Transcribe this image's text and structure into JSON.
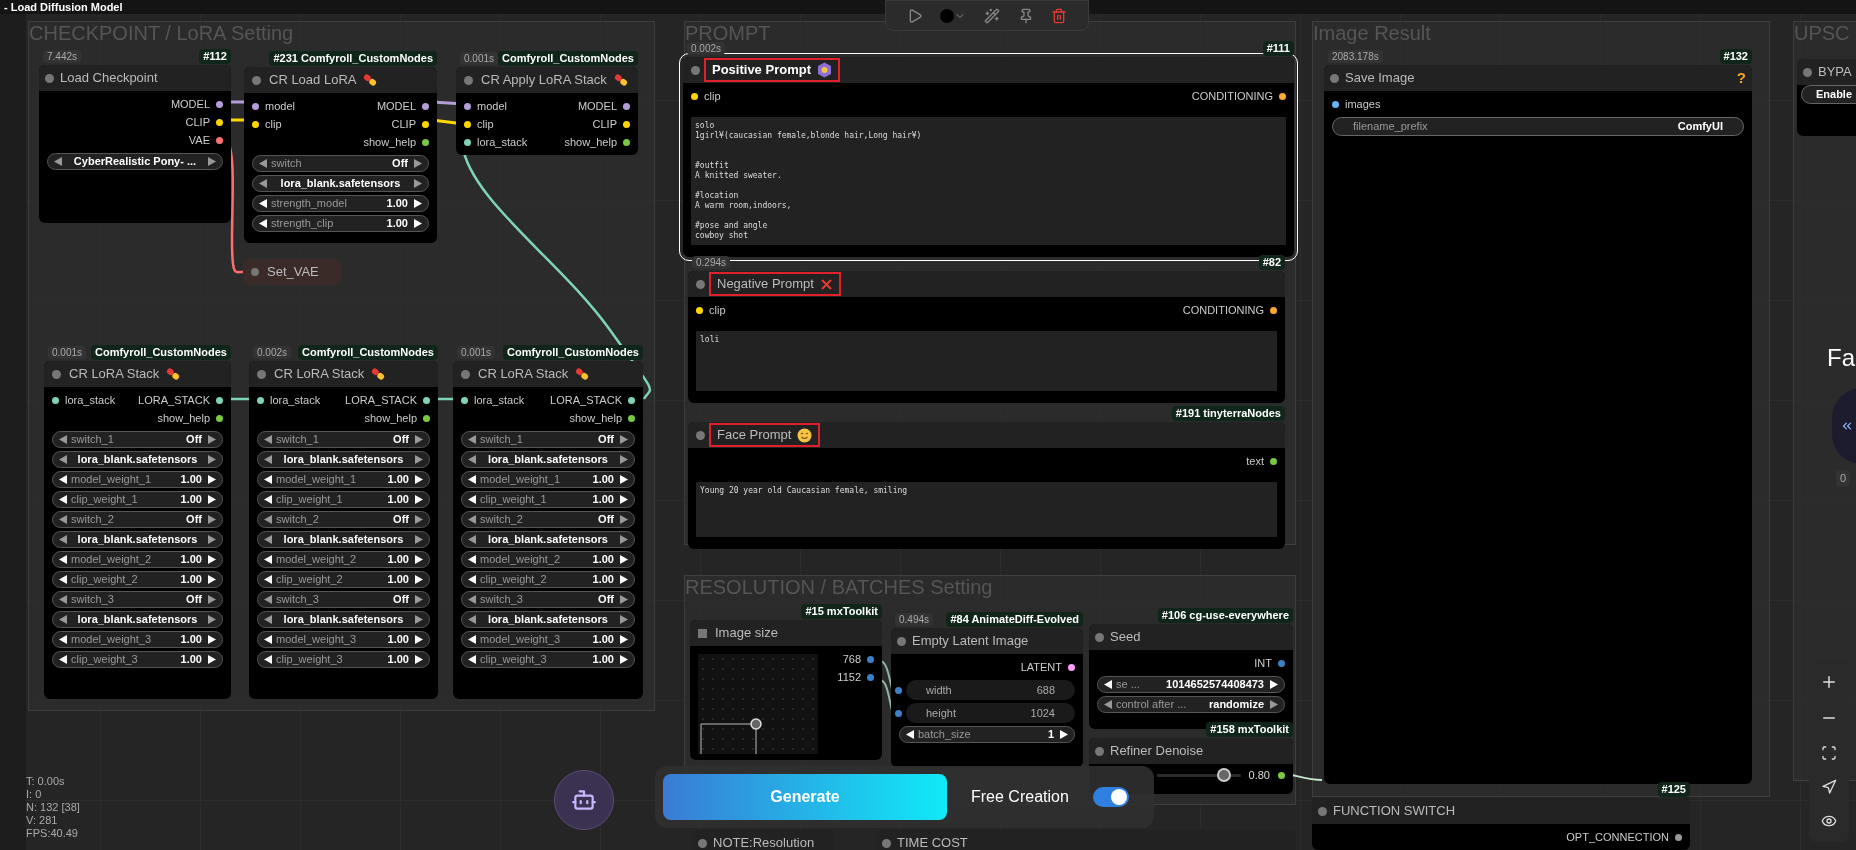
{
  "window": {
    "title": "- Load Diffusion Model"
  },
  "groups": [
    {
      "title": "CHECKPOINT / LoRA Setting"
    },
    {
      "title": "PROMPT"
    },
    {
      "title": "Image Result"
    },
    {
      "title": "UPSC"
    },
    {
      "title": "RESOLUTION / BATCHES Setting"
    }
  ],
  "nodes": [
    {
      "kind": "node",
      "title": "Load Checkpoint",
      "time": "7.442s",
      "id": "#112",
      "selected": false,
      "highlighted": false,
      "outputs": [
        {
          "label": "MODEL",
          "color": "#b39ddb"
        },
        {
          "label": "CLIP",
          "color": "#ffd500"
        },
        {
          "label": "VAE",
          "color": "#ff6e6e"
        }
      ],
      "widgets": [
        {
          "kind": "choice",
          "value": "CyberRealistic Pony- ..."
        }
      ]
    },
    {
      "kind": "node",
      "icon": {
        "kind": "pill"
      },
      "title": "CR Load LoRA",
      "id": "#231 Comfyroll_CustomNodes",
      "selected": false,
      "highlighted": false,
      "inputs": [
        {
          "label": "model",
          "color": "#b39ddb"
        },
        {
          "label": "clip",
          "color": "#ffd500"
        }
      ],
      "outputs": [
        {
          "label": "MODEL",
          "color": "#b39ddb"
        },
        {
          "label": "CLIP",
          "color": "#ffd500"
        },
        {
          "label": "show_help",
          "color": "#7ac943"
        }
      ],
      "widgets": [
        {
          "kind": "combo",
          "label": "switch",
          "value": "Off"
        },
        {
          "kind": "choice",
          "value": "lora_blank.safetensors"
        },
        {
          "kind": "number",
          "label": "strength_model",
          "value": "1.00"
        },
        {
          "kind": "number",
          "label": "strength_clip",
          "value": "1.00"
        }
      ]
    },
    {
      "kind": "node",
      "icon": {
        "kind": "pill"
      },
      "title": "CR Apply LoRA Stack",
      "time": "0.001s",
      "id": "Comfyroll_CustomNodes",
      "selected": false,
      "highlighted": false,
      "inputs": [
        {
          "label": "model",
          "color": "#b39ddb"
        },
        {
          "label": "clip",
          "color": "#ffd500"
        },
        {
          "label": "lora_stack",
          "color": "#7fd4b8"
        }
      ],
      "outputs": [
        {
          "label": "MODEL",
          "color": "#b39ddb"
        },
        {
          "label": "CLIP",
          "color": "#ffd500"
        },
        {
          "label": "show_help",
          "color": "#7ac943"
        }
      ]
    },
    {
      "kind": "reroute",
      "title": "Set_VAE",
      "selected": false,
      "highlighted": false
    },
    {
      "kind": "node",
      "icon": {
        "kind": "pill"
      },
      "title": "CR LoRA Stack",
      "time": "0.001s",
      "id": "Comfyroll_CustomNodes",
      "selected": false,
      "highlighted": false,
      "inputs": [
        {
          "label": "lora_stack",
          "color": "#7fd4b8"
        }
      ],
      "outputs": [
        {
          "label": "LORA_STACK",
          "color": "#7fd4b8"
        },
        {
          "label": "show_help",
          "color": "#7ac943"
        }
      ],
      "widgets": [
        {
          "kind": "combo",
          "label": "switch_1",
          "value": "Off"
        },
        {
          "kind": "choice",
          "value": "lora_blank.safetensors"
        },
        {
          "kind": "number",
          "label": "model_weight_1",
          "value": "1.00"
        },
        {
          "kind": "number",
          "label": "clip_weight_1",
          "value": "1.00"
        },
        {
          "kind": "combo",
          "label": "switch_2",
          "value": "Off"
        },
        {
          "kind": "choice",
          "value": "lora_blank.safetensors"
        },
        {
          "kind": "number",
          "label": "model_weight_2",
          "value": "1.00"
        },
        {
          "kind": "number",
          "label": "clip_weight_2",
          "value": "1.00"
        },
        {
          "kind": "combo",
          "label": "switch_3",
          "value": "Off"
        },
        {
          "kind": "choice",
          "value": "lora_blank.safetensors"
        },
        {
          "kind": "number",
          "label": "model_weight_3",
          "value": "1.00"
        },
        {
          "kind": "number",
          "label": "clip_weight_3",
          "value": "1.00"
        }
      ]
    },
    {
      "kind": "node",
      "icon": {
        "kind": "pill"
      },
      "title": "CR LoRA Stack",
      "time": "0.002s",
      "id": "Comfyroll_CustomNodes",
      "selected": false,
      "highlighted": false,
      "inputs": [
        {
          "label": "lora_stack",
          "color": "#7fd4b8"
        }
      ],
      "outputs": [
        {
          "label": "LORA_STACK",
          "color": "#7fd4b8"
        },
        {
          "label": "show_help",
          "color": "#7ac943"
        }
      ],
      "widgets": [
        {
          "kind": "combo",
          "label": "switch_1",
          "value": "Off"
        },
        {
          "kind": "choice",
          "value": "lora_blank.safetensors"
        },
        {
          "kind": "number",
          "label": "model_weight_1",
          "value": "1.00"
        },
        {
          "kind": "number",
          "label": "clip_weight_1",
          "value": "1.00"
        },
        {
          "kind": "combo",
          "label": "switch_2",
          "value": "Off"
        },
        {
          "kind": "choice",
          "value": "lora_blank.safetensors"
        },
        {
          "kind": "number",
          "label": "model_weight_2",
          "value": "1.00"
        },
        {
          "kind": "number",
          "label": "clip_weight_2",
          "value": "1.00"
        },
        {
          "kind": "combo",
          "label": "switch_3",
          "value": "Off"
        },
        {
          "kind": "choice",
          "value": "lora_blank.safetensors"
        },
        {
          "kind": "number",
          "label": "model_weight_3",
          "value": "1.00"
        },
        {
          "kind": "number",
          "label": "clip_weight_3",
          "value": "1.00"
        }
      ]
    },
    {
      "kind": "node",
      "icon": {
        "kind": "pill"
      },
      "title": "CR LoRA Stack",
      "time": "0.001s",
      "id": "Comfyroll_CustomNodes",
      "selected": false,
      "highlighted": false,
      "inputs": [
        {
          "label": "lora_stack",
          "color": "#7fd4b8"
        }
      ],
      "outputs": [
        {
          "label": "LORA_STACK",
          "color": "#7fd4b8"
        },
        {
          "label": "show_help",
          "color": "#7ac943"
        }
      ],
      "widgets": [
        {
          "kind": "combo",
          "label": "switch_1",
          "value": "Off"
        },
        {
          "kind": "choice",
          "value": "lora_blank.safetensors"
        },
        {
          "kind": "number",
          "label": "model_weight_1",
          "value": "1.00"
        },
        {
          "kind": "number",
          "label": "clip_weight_1",
          "value": "1.00"
        },
        {
          "kind": "combo",
          "label": "switch_2",
          "value": "Off"
        },
        {
          "kind": "choice",
          "value": "lora_blank.safetensors"
        },
        {
          "kind": "number",
          "label": "model_weight_2",
          "value": "1.00"
        },
        {
          "kind": "number",
          "label": "clip_weight_2",
          "value": "1.00"
        },
        {
          "kind": "combo",
          "label": "switch_3",
          "value": "Off"
        },
        {
          "kind": "choice",
          "value": "lora_blank.safetensors"
        },
        {
          "kind": "number",
          "label": "model_weight_3",
          "value": "1.00"
        },
        {
          "kind": "number",
          "label": "clip_weight_3",
          "value": "1.00"
        }
      ]
    },
    {
      "kind": "node",
      "icon": {
        "kind": "gem"
      },
      "title": "Positive Prompt",
      "time": "0.002s",
      "id": "#111",
      "selected": true,
      "highlighted": true,
      "inputs": [
        {
          "label": "clip",
          "color": "#ffd500"
        }
      ],
      "outputs": [
        {
          "label": "CONDITIONING",
          "color": "#ffa931"
        }
      ],
      "text": "solo\n1girl¥(caucasian female,blonde hair,Long hair¥)\n\n\n#outfit\nA knitted sweater.\n\n#location\nA warm room,indoors,\n\n#pose and angle\ncowboy shot"
    },
    {
      "kind": "node",
      "icon": {
        "kind": "cross"
      },
      "title": "Negative Prompt",
      "time": "0.294s",
      "id": "#82",
      "selected": false,
      "highlighted": true,
      "inputs": [
        {
          "label": "clip",
          "color": "#ffd500"
        }
      ],
      "outputs": [
        {
          "label": "CONDITIONING",
          "color": "#ffa931"
        }
      ],
      "text": "loli"
    },
    {
      "kind": "node",
      "icon": {
        "kind": "smile"
      },
      "title": "Face Prompt",
      "id": "#191 tinyterraNodes",
      "selected": false,
      "highlighted": true,
      "outputs": [
        {
          "label": "text",
          "color": "#7ac943"
        }
      ],
      "text": "Young 20 year old Caucasian female, smiling"
    },
    {
      "kind": "node",
      "title": "Save Image",
      "time": "2083.178s",
      "id": "#132",
      "help": "?",
      "selected": false,
      "highlighted": false,
      "inputs": [
        {
          "label": "images",
          "color": "#64b5f6"
        }
      ],
      "widgets": [
        {
          "kind": "field",
          "label": "filename_prefix",
          "value": "ComfyUI"
        }
      ]
    },
    {
      "kind": "node",
      "title": "BYPA",
      "selected": false,
      "highlighted": false,
      "widgets": [
        {
          "kind": "button",
          "value": "Enable"
        }
      ]
    },
    {
      "kind": "image_size",
      "title": "Image size",
      "id": "#15 mxToolkit",
      "selected": false,
      "highlighted": false,
      "outputs": [
        {
          "label": "768",
          "color": "#3b82c4"
        },
        {
          "label": "1152",
          "color": "#3b82c4"
        }
      ]
    },
    {
      "kind": "node",
      "title": "Empty Latent Image",
      "time": "0.494s",
      "id": "#84 AnimateDiff-Evolved",
      "selected": false,
      "highlighted": false,
      "outputs": [
        {
          "label": "LATENT",
          "color": "#ff9cf9"
        }
      ],
      "widgets": [
        {
          "kind": "input",
          "label": "width",
          "value": "688"
        },
        {
          "kind": "input",
          "label": "height",
          "value": "1024"
        },
        {
          "kind": "number",
          "label": "batch_size",
          "value": "1"
        }
      ]
    },
    {
      "kind": "node",
      "title": "Seed",
      "id": "#106 cg-use-everywhere",
      "selected": false,
      "highlighted": false,
      "outputs": [
        {
          "label": "INT",
          "color": "#3b82c4"
        }
      ],
      "widgets": [
        {
          "kind": "number",
          "label": "se ...",
          "value": "1014652574408473"
        },
        {
          "kind": "combo",
          "label": "control after ...",
          "value": "randomize"
        }
      ]
    },
    {
      "kind": "node",
      "title": "Refiner Denoise",
      "id": "#158 mxToolkit",
      "selected": false,
      "highlighted": false,
      "widgets": [
        {
          "kind": "slider",
          "level": 0.8,
          "value": "0.80",
          "color": "#7ac943"
        }
      ]
    },
    {
      "kind": "node",
      "title": "NOTE:Resolution",
      "selected": false,
      "highlighted": false
    },
    {
      "kind": "node",
      "title": "TIME COST",
      "selected": false,
      "highlighted": false
    },
    {
      "kind": "node",
      "title": "FUNCTION SWITCH",
      "id": "#125",
      "selected": false,
      "highlighted": false,
      "outputs": [
        {
          "label": "OPT_CONNECTION",
          "color": "#999999"
        }
      ]
    }
  ],
  "side_text": "Fa",
  "side_badge": "0",
  "stats": [
    "T: 0.00s",
    "I: 0",
    "N: 132 [38]",
    "V: 281",
    "FPS:40.49"
  ],
  "generate_bar": {
    "button": "Generate",
    "toggle_label": "Free Creation",
    "on": true
  }
}
